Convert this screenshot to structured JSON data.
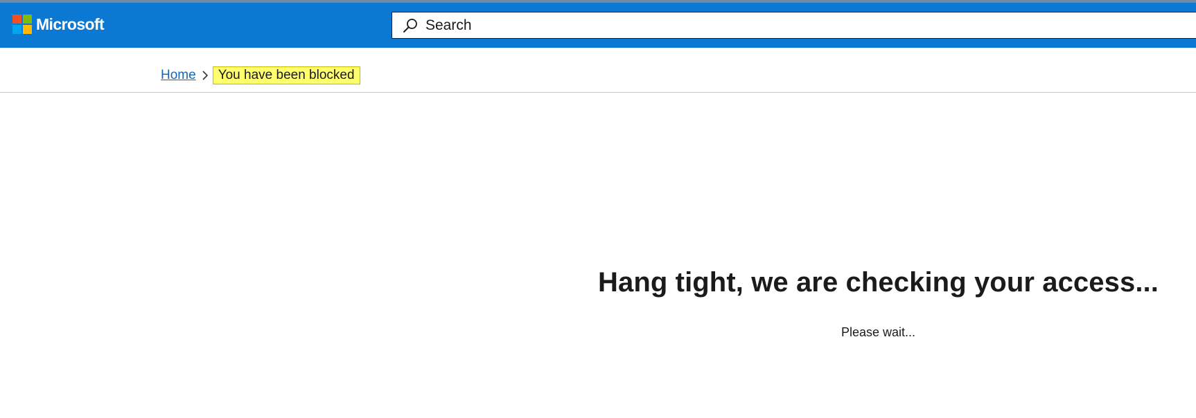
{
  "header": {
    "logo_text": "Microsoft",
    "logo_colors": [
      "#f25022",
      "#7fba00",
      "#00a4ef",
      "#ffb900"
    ],
    "background_color": "#0b78d3"
  },
  "search": {
    "placeholder": "Search",
    "icon": "search-icon"
  },
  "breadcrumb": {
    "home_label": "Home",
    "separator_icon": "chevron-right-icon",
    "current_label": "You have been blocked",
    "highlight_color": "#ffff6e"
  },
  "main": {
    "title": "Hang tight, we are checking your access...",
    "subtitle": "Please wait..."
  }
}
